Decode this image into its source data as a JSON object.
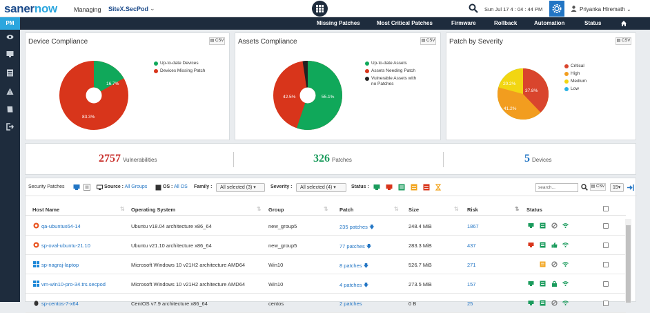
{
  "header": {
    "logo_part1": "saner",
    "logo_part2": "now",
    "managing_label": "Managing",
    "site_name": "SiteX.SecPod",
    "datetime": "Sun Jul 17  4 : 04 : 44 PM",
    "user_name": "Priyanka Hiremath"
  },
  "nav": {
    "module": "PM",
    "items": [
      "Missing Patches",
      "Most Critical Patches",
      "Firmware",
      "Rollback",
      "Automation",
      "Status"
    ]
  },
  "device_compliance": {
    "title": "Device Compliance",
    "csv": "CSV",
    "legend": [
      "Up-to-date Devices",
      "Devices Missing Patch"
    ],
    "labels": [
      "16.7%",
      "83.3%"
    ],
    "values": [
      16.7,
      83.3
    ],
    "colors": [
      "#10a85a",
      "#d8351b"
    ]
  },
  "assets_compliance": {
    "title": "Assets Compliance",
    "csv": "CSV",
    "legend": [
      "Up-to-date Assets",
      "Assets Needing Patch",
      "Vulnerable Assets with",
      "no Patches"
    ],
    "labels": [
      "55.1%",
      "42.5%"
    ],
    "values": [
      55.1,
      42.5,
      2.4
    ],
    "colors": [
      "#10a85a",
      "#d8351b",
      "#222222"
    ]
  },
  "patch_severity": {
    "title": "Patch by Severity",
    "csv": "CSV",
    "legend": [
      "Critical",
      "High",
      "Medium",
      "Low"
    ],
    "labels": [
      "37.8%",
      "41.2%",
      "20.2%"
    ],
    "values": [
      37.8,
      41.2,
      20.2,
      0.8
    ],
    "colors": [
      "#d9452d",
      "#f29d1f",
      "#f2d612",
      "#29b2e4"
    ]
  },
  "stats": {
    "vulnerabilities": {
      "value": "2757",
      "label": "Vulnerabilities",
      "color": "#c9302c"
    },
    "patches": {
      "value": "326",
      "label": "Patches",
      "color": "#1a9b5c"
    },
    "devices": {
      "value": "5",
      "label": "Devices",
      "color": "#2275c4"
    }
  },
  "filters": {
    "security_patches": "Security Patches",
    "source_label": "Source :",
    "source_value": "All Groups",
    "os_label": "OS :",
    "os_value": "All OS",
    "family_label": "Family :",
    "family_value": "All selected (3)",
    "severity_label": "Severity :",
    "severity_value": "All selected (4)",
    "status_label": "Status :",
    "search_placeholder": "search...",
    "csv": "CSV",
    "page_size": "15"
  },
  "table": {
    "columns": [
      "Host Name",
      "Operating System",
      "Group",
      "Patch",
      "Size",
      "Risk",
      "Status"
    ],
    "rows": [
      {
        "host": "qa-ubuntux64-14",
        "os": "Ubuntu v18.04 architecture x86_64",
        "group": "new_group5",
        "patch": "235 patches",
        "size": "248.4 MiB",
        "risk": "1867",
        "os_icon": "ubuntu-icon"
      },
      {
        "host": "sp-oval-ubuntu-21.10",
        "os": "Ubuntu v21.10 architecture x86_64",
        "group": "new_group5",
        "patch": "77 patches",
        "size": "283.3 MiB",
        "risk": "437",
        "os_icon": "ubuntu-icon"
      },
      {
        "host": "sp-nagraj-laptop",
        "os": "Microsoft Windows 10 v21H2 architecture AMD64",
        "group": "Win10",
        "patch": "8 patches",
        "size": "526.7 MiB",
        "risk": "271",
        "os_icon": "windows-icon"
      },
      {
        "host": "vm-win10-pro-34.trs.secpod",
        "os": "Microsoft Windows 10 v21H2 architecture AMD64",
        "group": "Win10",
        "patch": "4 patches",
        "size": "273.5 MiB",
        "risk": "157",
        "os_icon": "windows-icon"
      },
      {
        "host": "sp-centos-7-x64",
        "os": "CentOS v7.9 architecture x86_64",
        "group": "centos",
        "patch": "2 patches",
        "size": "0 B",
        "risk": "25",
        "os_icon": "linux-icon"
      }
    ]
  }
}
